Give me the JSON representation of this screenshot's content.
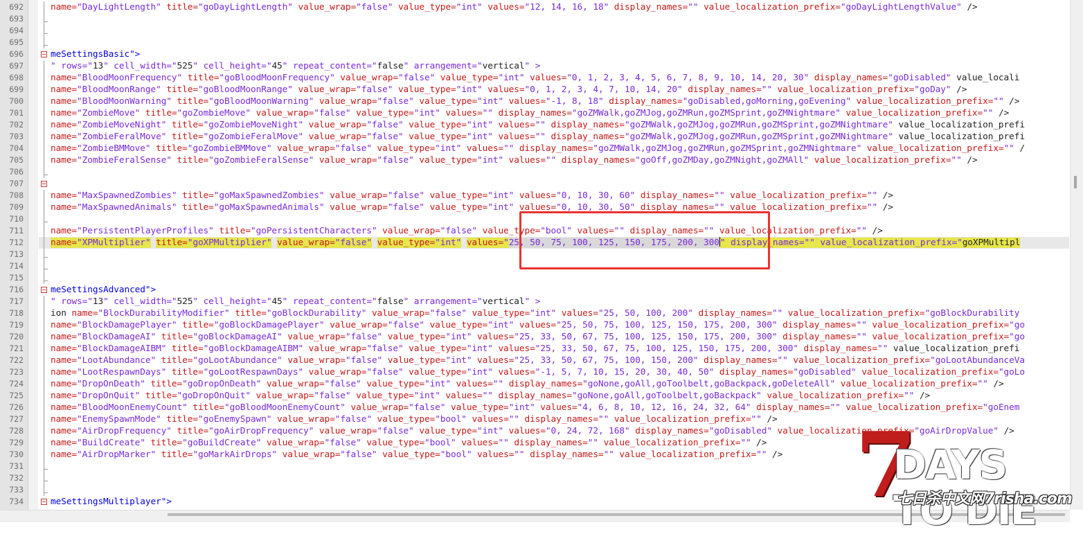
{
  "editor": {
    "line_numbers": [
      "692",
      "693",
      "694",
      "695",
      "696",
      "697",
      "698",
      "699",
      "700",
      "701",
      "702",
      "703",
      "704",
      "705",
      "706",
      "707",
      "708",
      "709",
      "710",
      "711",
      "712",
      "713",
      "714",
      "715",
      "716",
      "717",
      "718",
      "719",
      "720",
      "721",
      "722",
      "723",
      "724",
      "725",
      "726",
      "727",
      "728",
      "729",
      "730",
      "731",
      "732",
      "733",
      "734"
    ],
    "highlighted_line": "712",
    "lines": {
      "l692": "name=\"DayLightLength\" title=\"goDayLightLength\" value_wrap=\"false\" value_type=\"int\" values=\"12, 14, 16, 18\" display_names=\"\" value_localization_prefix=\"goDayLightLengthValue\" />",
      "l696": "meSettingsBasic\">",
      "l697": "\" rows=\"13\" cell_width=\"525\" cell_height=\"45\" repeat_content=\"false\" arrangement=\"vertical\" >",
      "l698": "name=\"BloodMoonFrequency\" title=\"goBloodMoonFrequency\" value_wrap=\"false\" value_type=\"int\" values=\"0, 1, 2, 3, 4, 5, 6, 7, 8, 9, 10, 14, 20, 30\" display_names=\"goDisabled\" value_locali",
      "l699": "name=\"BloodMoonRange\" title=\"goBloodMoonRange\" value_wrap=\"false\" value_type=\"int\" values=\"0, 1, 2, 3, 4, 7, 10, 14, 20\" display_names=\"\" value_localization_prefix=\"goDay\" />",
      "l700": "name=\"BloodMoonWarning\" title=\"goBloodMoonWarning\" value_wrap=\"false\" value_type=\"int\" values=\"-1, 8, 18\" display_names=\"goDisabled,goMorning,goEvening\" value_localization_prefix=\"\" />",
      "l701": "name=\"ZombieMove\" title=\"goZombieMove\" value_wrap=\"false\" value_type=\"int\" values=\"\" display_names=\"goZMWalk,goZMJog,goZMRun,goZMSprint,goZMNightmare\" value_localization_prefix=\"\" />",
      "l702": "name=\"ZombieMoveNight\" title=\"goZombieMoveNight\" value_wrap=\"false\" value_type=\"int\" values=\"\" display_names=\"goZMWalk,goZMJog,goZMRun,goZMSprint,goZMNightmare\" value_localization_prefi",
      "l703": "name=\"ZombieFeralMove\" title=\"goZombieFeralMove\" value_wrap=\"false\" value_type=\"int\" values=\"\" display_names=\"goZMWalk,goZMJog,goZMRun,goZMSprint,goZMNightmare\" value_localization_prefi",
      "l704": "name=\"ZombieBMMove\" title=\"goZombieBMMove\" value_wrap=\"false\" value_type=\"int\" values=\"\" display_names=\"goZMWalk,goZMJog,goZMRun,goZMSprint,goZMNightmare\" value_localization_prefix=\"\" /",
      "l705": "name=\"ZombieFeralSense\" title=\"goZombieFeralSense\" value_wrap=\"false\" value_type=\"int\" values=\"\" display_names=\"goOff,goZMDay,goZMNight,goZMAll\" value_localization_prefix=\"\" />",
      "l708": "name=\"MaxSpawnedZombies\" title=\"goMaxSpawnedZombies\" value_wrap=\"false\" value_type=\"int\" values=\"0, 10, 30, 60\" display_names=\"\" value_localization_prefix=\"\" />",
      "l709": "name=\"MaxSpawnedAnimals\" title=\"goMaxSpawnedAnimals\" value_wrap=\"false\" value_type=\"int\" values=\"0, 10, 30, 50\" display_names=\"\" value_localization_prefix=\"\" />",
      "l711": "name=\"PersistentPlayerProfiles\" title=\"goPersistentCharacters\" value_wrap=\"false\" value_type=\"bool\" values=\"\" display_names=\"\" value_localization_prefix=\"\" />",
      "l712_a": "name=\"XPMultiplier\" title=\"goXPMultiplier\" value_wrap=\"false\" value_type=\"int\" values=\"",
      "l712_sel": "25, 50, 75, 100, 125, 150, 175, 200, 300",
      "l712_b": "\" display_names=\"\" value_localization_prefix=\"goXPMultipl",
      "l716": "meSettingsAdvanced\">",
      "l717": "\" rows=\"13\" cell_width=\"525\" cell_height=\"45\" repeat_content=\"false\" arrangement=\"vertical\" >",
      "l718": "ion name=\"BlockDurabilityModifier\" title=\"goBlockDurability\" value_wrap=\"false\" value_type=\"int\" values=\"25, 50, 100, 200\" display_names=\"\" value_localization_prefix=\"goBlockDurability",
      "l719": "name=\"BlockDamagePlayer\" title=\"goBlockDamagePlayer\" value_wrap=\"false\" value_type=\"int\" values=\"25, 50, 75, 100, 125, 150, 175, 200, 300\" display_names=\"\" value_localization_prefix=\"go",
      "l720": "name=\"BlockDamageAI\" title=\"goBlockDamageAI\" value_wrap=\"false\" value_type=\"int\" values=\"25, 33, 50, 67, 75, 100, 125, 150, 175, 200, 300\" display_names=\"\" value_localization_prefix=\"go",
      "l721": "name=\"BlockDamageAIBM\" title=\"goBlockDamageAIBM\" value_wrap=\"false\" value_type=\"int\" values=\"25, 33, 50, 67, 75, 100, 125, 150, 175, 200, 300\" display_names=\"\" value_localization_prefi",
      "l722": "name=\"LootAbundance\" title=\"goLootAbundance\" value_wrap=\"false\" value_type=\"int\" values=\"25, 33, 50, 67, 75, 100, 150, 200\" display_names=\"\" value_localization_prefix=\"goLootAbundanceVa",
      "l723": "name=\"LootRespawnDays\" title=\"goLootRespawnDays\" value_wrap=\"false\" value_type=\"int\" values=\"-1, 5, 7, 10, 15, 20, 30, 40, 50\" display_names=\"goDisabled\" value_localization_prefix=\"goLo",
      "l724": "name=\"DropOnDeath\" title=\"goDropOnDeath\" value_wrap=\"false\" value_type=\"int\" values=\"\" display_names=\"goNone,goAll,goToolbelt,goBackpack,goDeleteAll\" value_localization_prefix=\"\" />",
      "l725": "name=\"DropOnQuit\" title=\"goDropOnQuit\" value_wrap=\"false\" value_type=\"int\" values=\"\" display_names=\"goNone,goAll,goToolbelt,goBackpack\" value_localization_prefix=\"\" />",
      "l726": "name=\"BloodMoonEnemyCount\" title=\"goBloodMoonEnemyCount\" value_wrap=\"false\" value_type=\"int\" values=\"4, 6, 8, 10, 12, 16, 24, 32, 64\" display_names=\"\" value_localization_prefix=\"goEnem",
      "l727": "name=\"EnemySpawnMode\" title=\"goEnemySpawn\" value_wrap=\"false\" value_type=\"bool\" values=\"\" display_names=\"\" value_localization_prefix=\"\" />",
      "l728": "name=\"AirDropFrequency\" title=\"goAirDropFrequency\" value_wrap=\"false\" value_type=\"int\" values=\"0, 24, 72, 168\" display_names=\"goDisabled\" value_localization_prefix=\"goAirDropValue\" />",
      "l729": "name=\"BuildCreate\" title=\"goBuildCreate\" value_wrap=\"false\" value_type=\"bool\" values=\"\" display_names=\"\" value_localization_prefix=\"\" />",
      "l730": "name=\"AirDropMarker\" title=\"goMarkAirDrops\" value_wrap=\"false\" value_type=\"bool\" values=\"\" display_names=\"\" value_localization_prefix=\"\" />",
      "l734": "meSettingsMultiplayer\">"
    }
  },
  "watermark": {
    "numeral": "7",
    "title": "DAYS TO DIE",
    "site": "七日杀中文网7risha.com"
  },
  "colors": {
    "attribute": "#c51a1a",
    "value": "#7a2ad6",
    "tag": "#0000e6",
    "highlight": "#e6e64d",
    "annotation_box": "#e8332f"
  }
}
